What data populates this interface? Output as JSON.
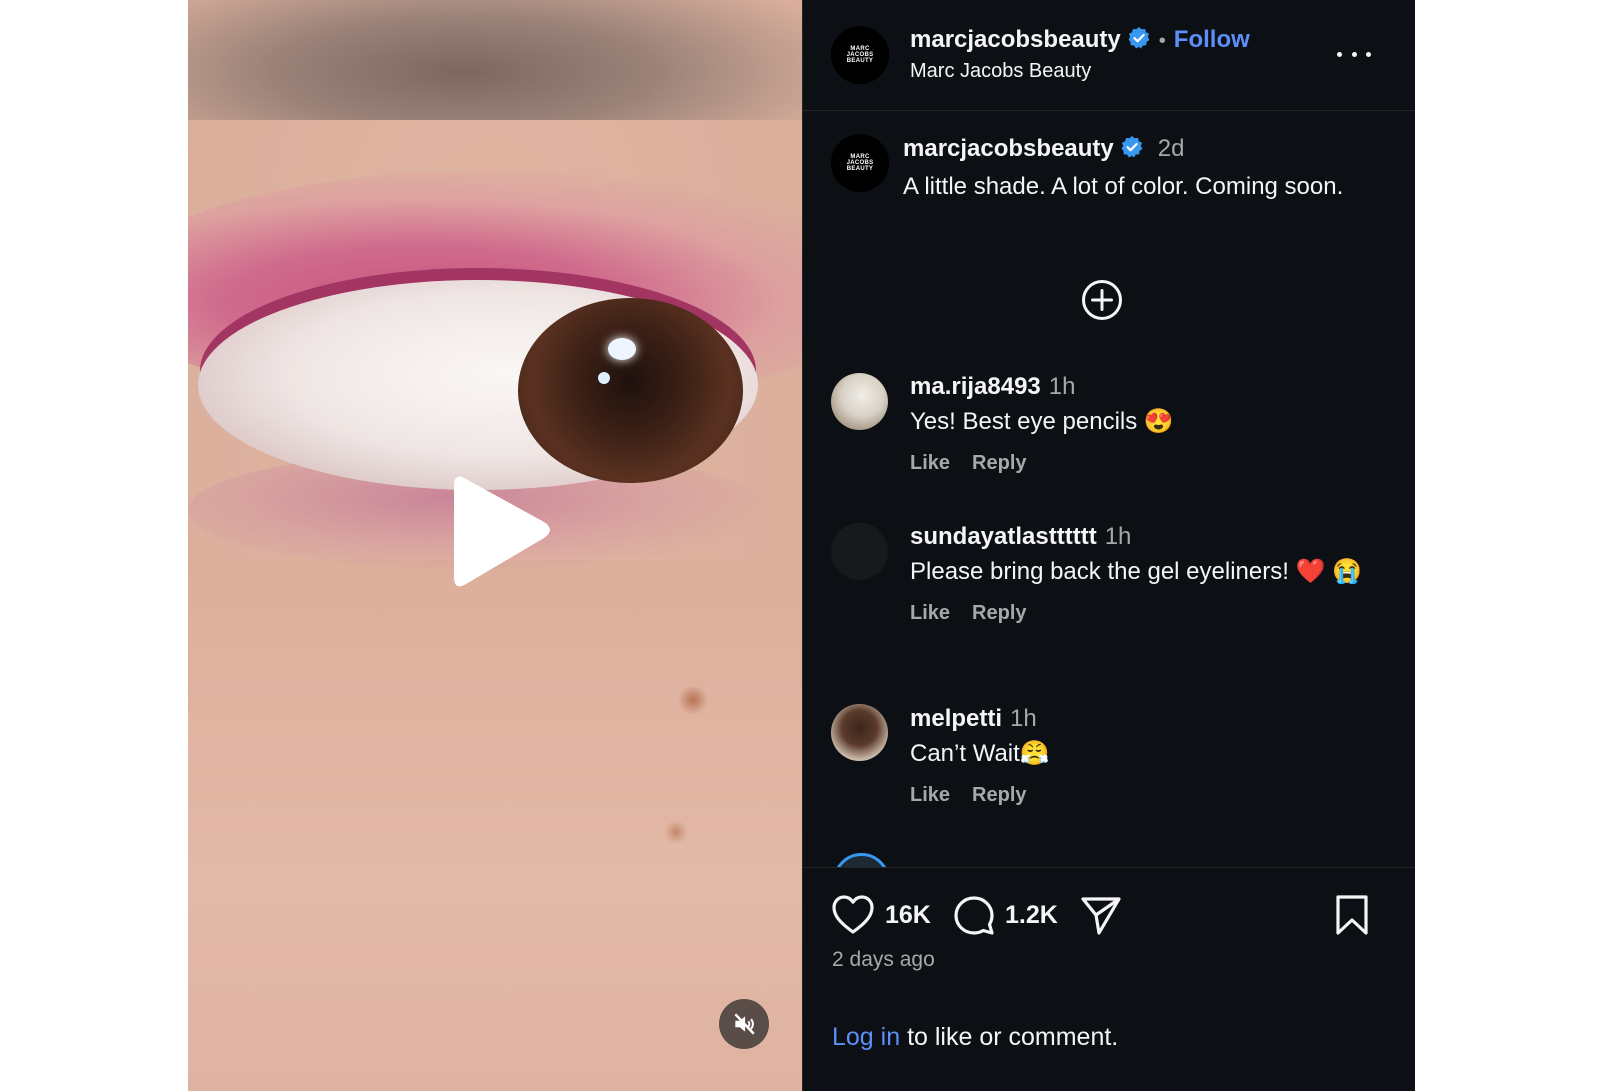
{
  "post": {
    "account": {
      "username": "marcjacobsbeauty",
      "full_name": "Marc Jacobs Beauty",
      "verified": true,
      "follow_label": "Follow",
      "separator": "•",
      "avatar_text": "MARC JACOBS BEAUTY"
    },
    "caption": {
      "username": "marcjacobsbeauty",
      "time": "2d",
      "text": "A little shade. A lot of color. Coming soon."
    },
    "media": {
      "type": "video",
      "muted": true,
      "icons": {
        "play": "play-icon",
        "mute": "speaker-muted-icon"
      }
    },
    "comments": [
      {
        "username": "ma.rija8493",
        "time": "1h",
        "text": "Yes! Best eye pencils 😍",
        "like_label": "Like",
        "reply_label": "Reply"
      },
      {
        "username": "sundayatlastttttt",
        "time": "1h",
        "text": "Please bring back the gel eyeliners! ❤️ 😭",
        "like_label": "Like",
        "reply_label": "Reply"
      },
      {
        "username": "melpetti",
        "time": "1h",
        "text": "Can’t Wait😤",
        "like_label": "Like",
        "reply_label": "Reply"
      }
    ],
    "stats": {
      "likes": "16K",
      "comments": "1.2K",
      "posted": "2 days ago"
    },
    "login_prompt": {
      "link": "Log in",
      "rest": " to like or comment."
    },
    "colors": {
      "panel_bg": "#0c1014",
      "link_blue": "#5d8ef7",
      "verified_blue": "#3897f0",
      "secondary_text": "#a8a8a8"
    }
  }
}
